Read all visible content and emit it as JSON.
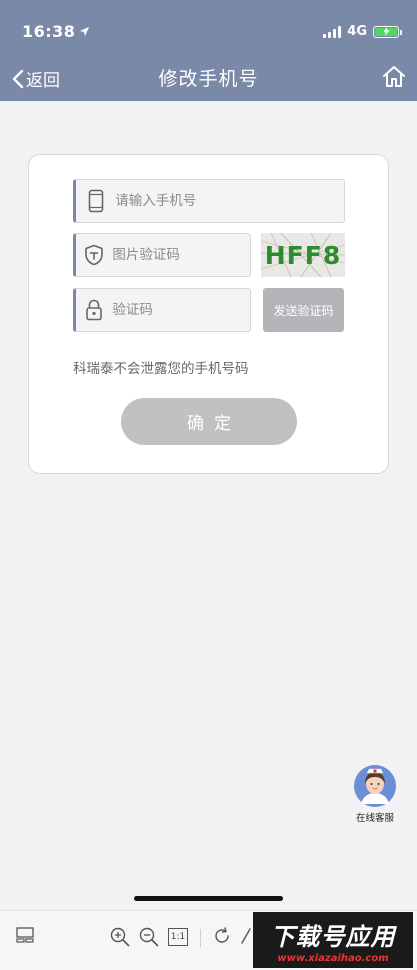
{
  "status_bar": {
    "time": "16:38",
    "network": "4G"
  },
  "nav": {
    "back_label": "返回",
    "title": "修改手机号"
  },
  "form": {
    "phone_placeholder": "请输入手机号",
    "captcha_placeholder": "图片验证码",
    "captcha_text": "HFF8",
    "code_placeholder": "验证码",
    "send_code_label": "发送验证码",
    "privacy_note": "科瑞泰不会泄露您的手机号码",
    "confirm_label": "确定"
  },
  "service": {
    "label": "在线客服"
  },
  "toolbar": {
    "ratio_label": "1:1"
  },
  "watermark": {
    "main": "下载号应用",
    "sub": "www.xiazaihao.com"
  },
  "colors": {
    "accent": "#7b89a8",
    "button_disabled": "#c1c1c4",
    "send_disabled": "#b5b5b9",
    "captcha_green": "#2e8b2e"
  },
  "icons": {
    "back": "chevron-left-icon",
    "home": "home-icon",
    "phone": "phone-icon",
    "captcha": "shield-icon",
    "code": "lock-icon"
  }
}
